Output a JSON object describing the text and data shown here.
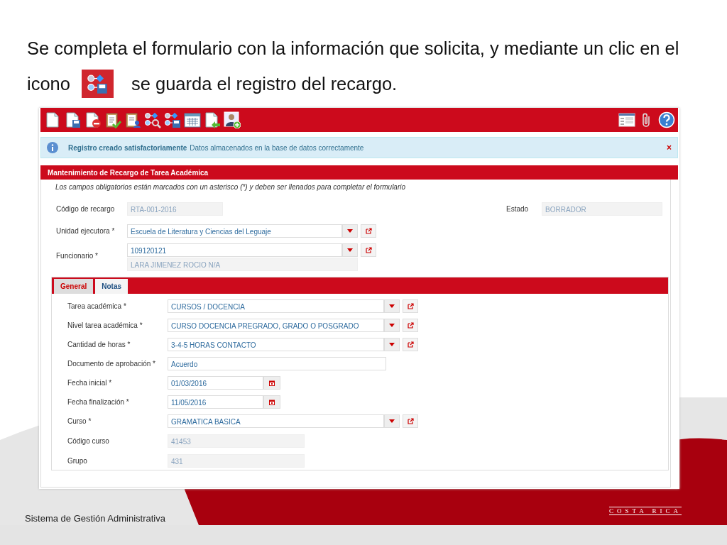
{
  "caption": {
    "line_1": "Se completa el formulario con la información que solicita, y mediante un clic en el",
    "before_icon": "icono",
    "after_icon": "se guarda el registro del recargo."
  },
  "toolbar": {
    "left": [
      {
        "kind": "page"
      },
      {
        "kind": "page-save"
      },
      {
        "kind": "page-remove"
      },
      {
        "kind": "clipboard-check"
      },
      {
        "kind": "clipboard-user"
      },
      {
        "kind": "flow-search"
      },
      {
        "kind": "flow-save"
      },
      {
        "kind": "window-grid"
      },
      {
        "kind": "page-arrow"
      },
      {
        "kind": "user-add"
      }
    ],
    "right": [
      {
        "kind": "window-form"
      },
      {
        "kind": "paperclip"
      },
      {
        "kind": "help"
      }
    ]
  },
  "alert": {
    "title": "Registro creado satisfactoriamente",
    "message": "Datos almacenados en la base de datos correctamente",
    "close": "×"
  },
  "form": {
    "title": "Mantenimiento de Recargo de Tarea Académica",
    "note": "Los campos obligatorios están marcados con un asterisco (*) y deben ser llenados para completar el formulario",
    "codigo": {
      "label": "Código de recargo",
      "value": "RTA-001-2016"
    },
    "estado": {
      "label": "Estado",
      "value": "BORRADOR"
    },
    "unidad": {
      "label": "Unidad ejecutora *",
      "value": "Escuela de Literatura y Ciencias del Leguaje"
    },
    "funcionario": {
      "label": "Funcionario *",
      "value": "109120121",
      "detail": "LARA  JIMENEZ ROCIO N/A"
    }
  },
  "tabs": [
    {
      "label": "General",
      "selected": false
    },
    {
      "label": "Notas",
      "selected": true
    }
  ],
  "tab_fields": [
    {
      "kind": "select",
      "label": "Tarea académica *",
      "value": "CURSOS / DOCENCIA"
    },
    {
      "kind": "select",
      "label": "Nivel tarea académica *",
      "value": "CURSO DOCENCIA PREGRADO, GRADO O POSGRADO"
    },
    {
      "kind": "select",
      "label": "Cantidad de horas *",
      "value": "3-4-5 HORAS CONTACTO"
    },
    {
      "kind": "text",
      "label": "Documento de aprobación *",
      "value": "Acuerdo"
    },
    {
      "kind": "date",
      "label": "Fecha inicial *",
      "value": "01/03/2016"
    },
    {
      "kind": "date",
      "label": "Fecha finalización *",
      "value": "11/05/2016"
    },
    {
      "kind": "select",
      "label": "Curso *",
      "value": "GRAMATICA BASICA"
    },
    {
      "kind": "readonly",
      "label": "Código curso",
      "value": "41453"
    },
    {
      "kind": "readonly",
      "label": "Grupo",
      "value": "431"
    }
  ],
  "footer": {
    "subtitle": "Sistema de Gestión Administrativa",
    "country": "COSTA RICA"
  }
}
